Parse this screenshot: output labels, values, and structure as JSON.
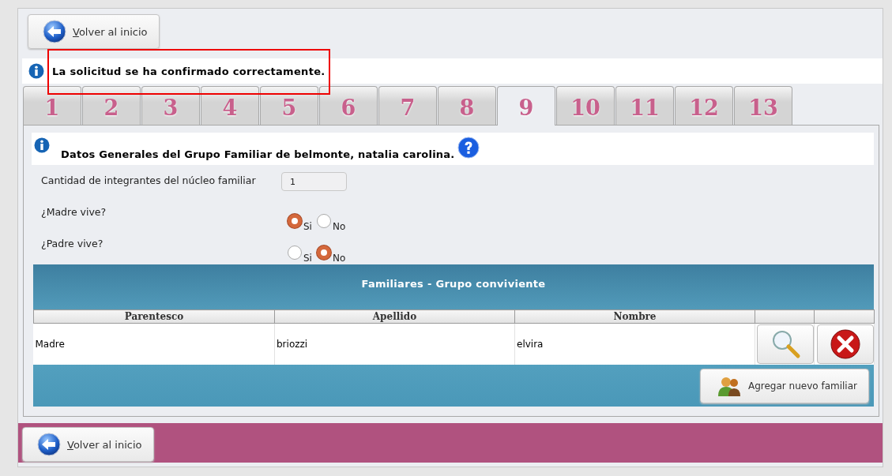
{
  "top_button": {
    "label": "Volver al inicio"
  },
  "message": {
    "text": "La solicitud se ha confirmado correctamente.",
    "highlighted": true
  },
  "tabs": [
    {
      "label": "1",
      "selected": false
    },
    {
      "label": "2",
      "selected": false
    },
    {
      "label": "3",
      "selected": false
    },
    {
      "label": "4",
      "selected": false
    },
    {
      "label": "5",
      "selected": false
    },
    {
      "label": "6",
      "selected": false
    },
    {
      "label": "7",
      "selected": false
    },
    {
      "label": "8",
      "selected": false
    },
    {
      "label": "9",
      "selected": true
    },
    {
      "label": "10",
      "selected": false
    },
    {
      "label": "11",
      "selected": false
    },
    {
      "label": "12",
      "selected": false
    },
    {
      "label": "13",
      "selected": false
    }
  ],
  "section_title": "Datos Generales del Grupo Familiar de belmonte, natalia carolina.",
  "members_field": {
    "label": "Cantidad de integrantes del núcleo familiar",
    "value": "1"
  },
  "questions": [
    {
      "label": "¿Madre vive?",
      "options": [
        {
          "label": "Si",
          "selected": true
        },
        {
          "label": "No",
          "selected": false
        }
      ]
    },
    {
      "label": "¿Padre vive?",
      "options": [
        {
          "label": "Si",
          "selected": false
        },
        {
          "label": "No",
          "selected": true
        }
      ]
    }
  ],
  "table": {
    "title": "Familiares - Grupo conviviente",
    "columns": [
      "Parentesco",
      "Apellido",
      "Nombre"
    ],
    "rows": [
      {
        "cells": [
          "Madre",
          "briozzi",
          "elvira"
        ]
      }
    ],
    "add_button": "Agregar nuevo familiar"
  },
  "bottom_button": {
    "label": "Volver al inicio"
  }
}
